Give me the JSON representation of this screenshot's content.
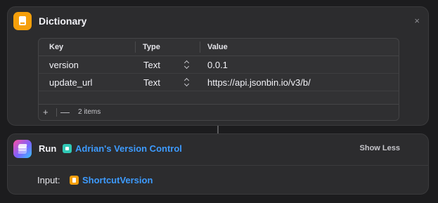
{
  "dictionary": {
    "title": "Dictionary",
    "close_glyph": "×",
    "columns": {
      "key": "Key",
      "type": "Type",
      "value": "Value"
    },
    "rows": [
      {
        "key": "version",
        "type": "Text",
        "value": "0.0.1"
      },
      {
        "key": "update_url",
        "type": "Text",
        "value": "https://api.jsonbin.io/v3/b/"
      }
    ],
    "footer": {
      "add": "+",
      "remove": "—",
      "count": "2 items"
    }
  },
  "run": {
    "label": "Run",
    "shortcut_name": "Adrian's Version Control",
    "show_less": "Show Less",
    "input_label": "Input:",
    "input_value": "ShortcutVersion"
  },
  "colors": {
    "accent": "#3d9bff",
    "dictionary_icon": "#f59f0b",
    "shortcut_chip": "#30c9b6"
  },
  "icons": {
    "dictionary": "book-icon",
    "run": "shortcuts-icon",
    "shortcut_chip": "shortcut-glyph-icon",
    "input_chip": "dictionary-variable-icon"
  }
}
